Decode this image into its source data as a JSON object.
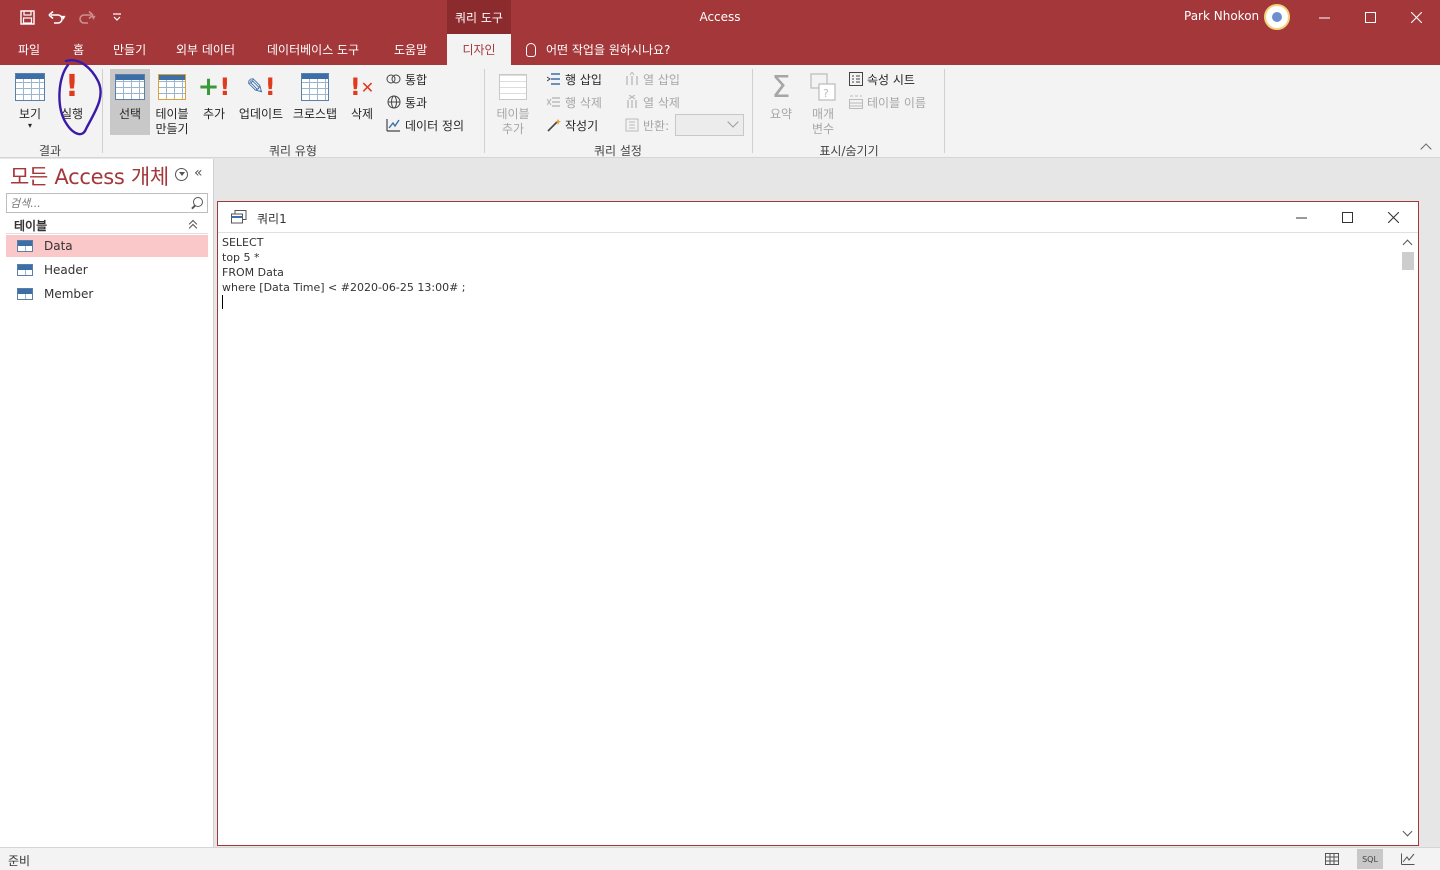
{
  "app": {
    "title": "Access",
    "context_tab_title": "쿼리 도구",
    "user_name": "Park Nhokon"
  },
  "tabs": [
    {
      "label": "파일"
    },
    {
      "label": "홈"
    },
    {
      "label": "만들기"
    },
    {
      "label": "외부 데이터"
    },
    {
      "label": "데이터베이스 도구"
    },
    {
      "label": "도움말"
    },
    {
      "label": "디자인",
      "active": true
    }
  ],
  "tell_me": "어떤 작업을 원하시나요?",
  "ribbon": {
    "results": {
      "label": "결과",
      "view": "보기",
      "run": "실행"
    },
    "query_type": {
      "label": "쿼리 유형",
      "select": "선택",
      "make_table_1": "테이블",
      "make_table_2": "만들기",
      "append": "추가",
      "update": "업데이트",
      "crosstab": "크로스탭",
      "delete": "삭제",
      "union": "통합",
      "pass_through": "통과",
      "data_definition": "데이터 정의"
    },
    "query_setup": {
      "label": "쿼리 설정",
      "show_table_1": "테이블",
      "show_table_2": "추가",
      "insert_rows": "행 삽입",
      "delete_rows": "행 삭제",
      "builder": "작성기",
      "insert_columns": "열 삽입",
      "delete_columns": "열 삭제",
      "return": "반환:"
    },
    "show_hide": {
      "label": "표시/숨기기",
      "totals": "요약",
      "parameters_1": "매개",
      "parameters_2": "변수",
      "property_sheet": "속성 시트",
      "table_names": "테이블 이름"
    }
  },
  "nav": {
    "title": "모든 Access 개체",
    "search_placeholder": "검색...",
    "group": "테이블",
    "items": [
      {
        "label": "Data",
        "selected": true
      },
      {
        "label": "Header"
      },
      {
        "label": "Member"
      }
    ]
  },
  "document": {
    "title": "쿼리1",
    "sql_lines": [
      "SELECT",
      "top 5 *",
      "FROM Data",
      "where [Data Time] < #2020-06-25 13:00# ;"
    ]
  },
  "status": {
    "text": "준비",
    "sql_view": "SQL"
  },
  "colors": {
    "accent": "#a4373a",
    "nav_selected": "#fbc8ca",
    "annotation_ink": "#3a1aa8"
  }
}
